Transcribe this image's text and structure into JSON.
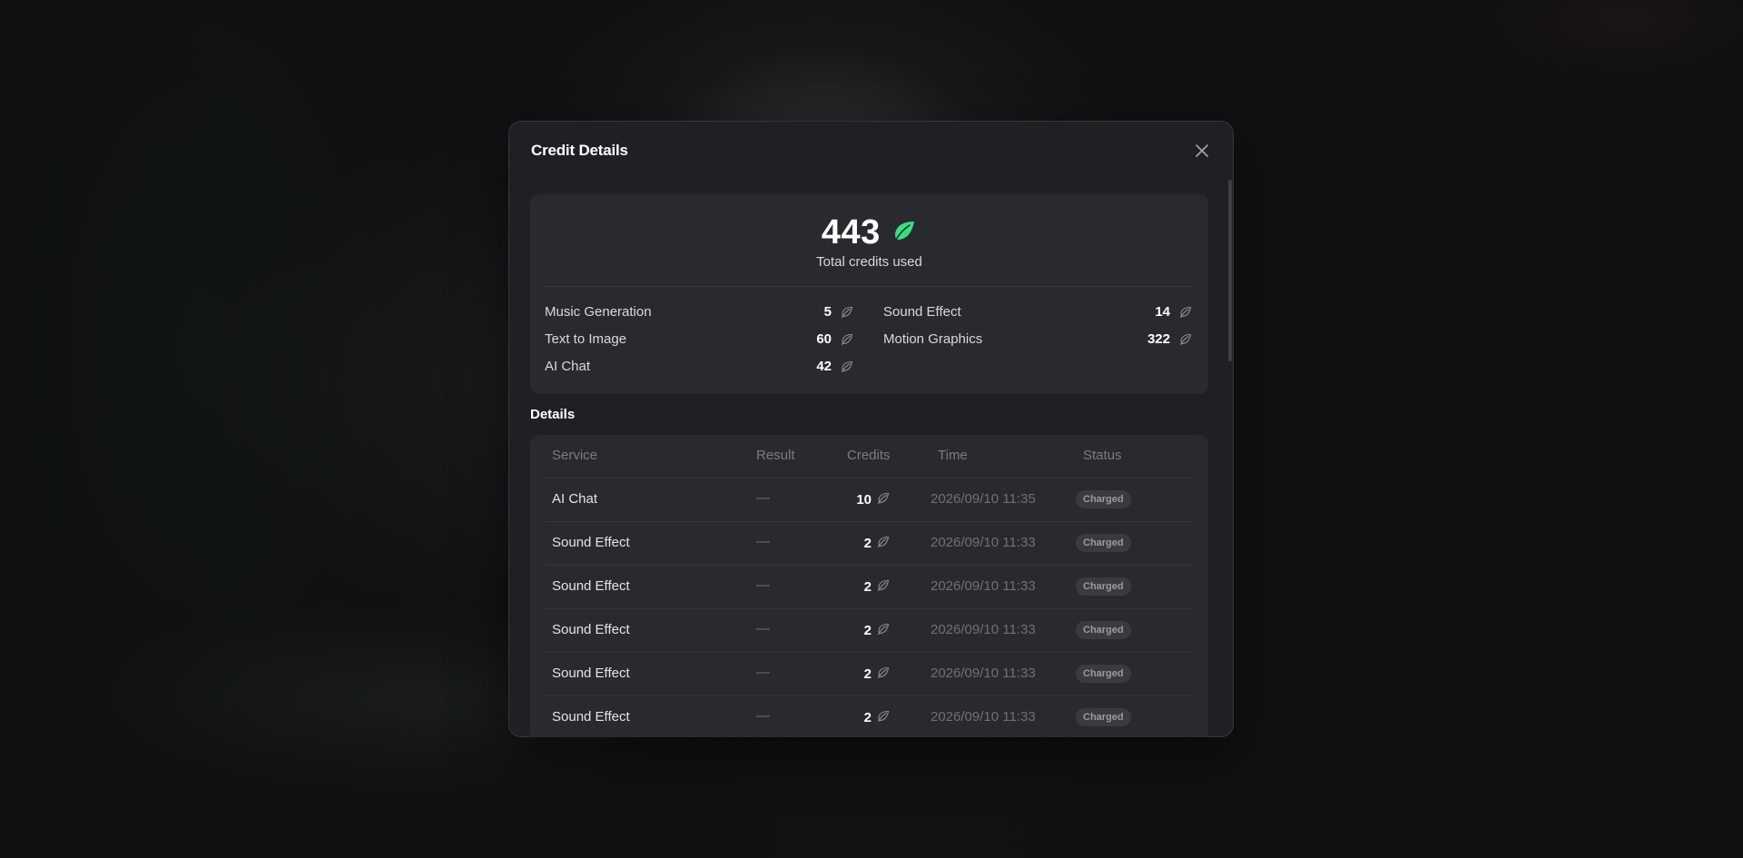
{
  "modal": {
    "title": "Credit Details",
    "close_label": "close"
  },
  "summary": {
    "total": "443",
    "total_label": "Total credits used",
    "services": [
      {
        "name": "Music Generation",
        "value": "5"
      },
      {
        "name": "Sound Effect",
        "value": "14"
      },
      {
        "name": "Text to Image",
        "value": "60"
      },
      {
        "name": "Motion Graphics",
        "value": "322"
      },
      {
        "name": "AI Chat",
        "value": "42"
      }
    ]
  },
  "details": {
    "title": "Details",
    "columns": {
      "service": "Service",
      "result": "Result",
      "credits": "Credits",
      "time": "Time",
      "status": "Status"
    },
    "rows": [
      {
        "service": "AI Chat",
        "result": "—",
        "credits": "10",
        "time": "2026/09/10 11:35",
        "status": "Charged"
      },
      {
        "service": "Sound Effect",
        "result": "—",
        "credits": "2",
        "time": "2026/09/10 11:33",
        "status": "Charged"
      },
      {
        "service": "Sound Effect",
        "result": "—",
        "credits": "2",
        "time": "2026/09/10 11:33",
        "status": "Charged"
      },
      {
        "service": "Sound Effect",
        "result": "—",
        "credits": "2",
        "time": "2026/09/10 11:33",
        "status": "Charged"
      },
      {
        "service": "Sound Effect",
        "result": "—",
        "credits": "2",
        "time": "2026/09/10 11:33",
        "status": "Charged"
      },
      {
        "service": "Sound Effect",
        "result": "—",
        "credits": "2",
        "time": "2026/09/10 11:33",
        "status": "Charged"
      }
    ]
  },
  "icons": {
    "credit": "leaf-icon",
    "close": "close-icon"
  },
  "colors": {
    "accent_leaf": "#3ddc84",
    "modal_bg": "#1f2024",
    "card_bg": "#292a2f"
  }
}
